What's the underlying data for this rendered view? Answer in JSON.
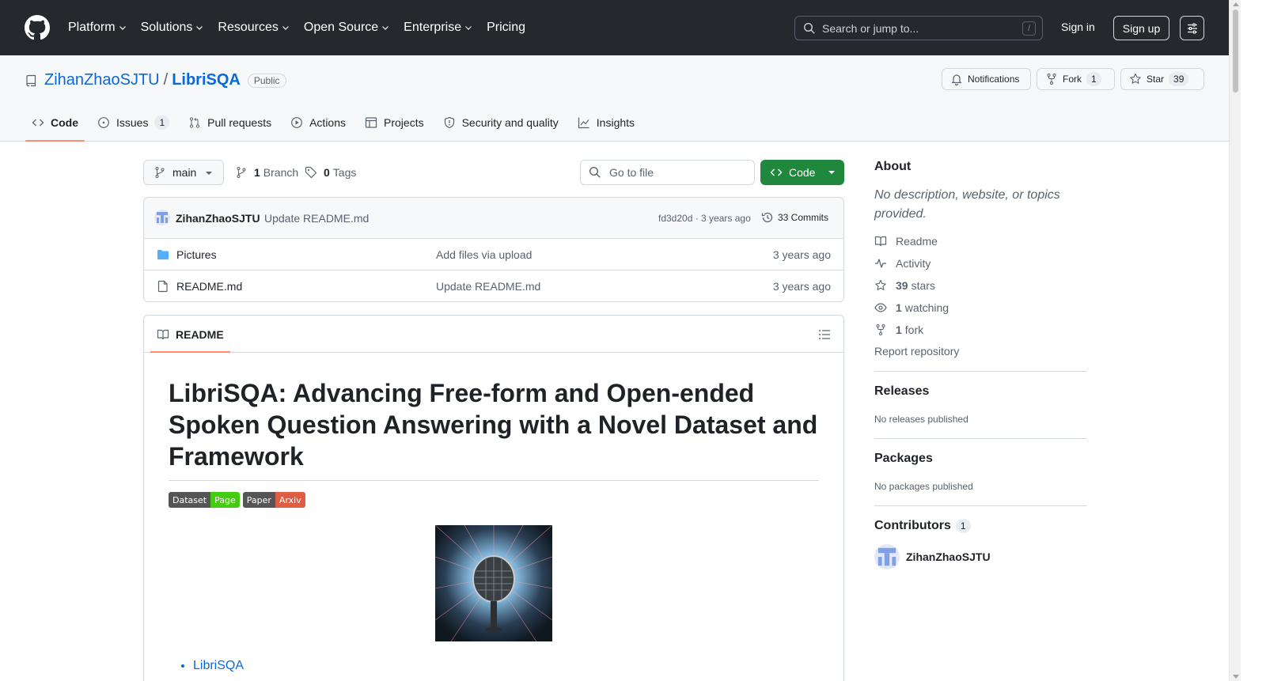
{
  "topnav": {
    "items": [
      "Platform",
      "Solutions",
      "Resources",
      "Open Source",
      "Enterprise",
      "Pricing"
    ],
    "search_placeholder": "Search or jump to...",
    "search_shortcut": "/",
    "signin": "Sign in",
    "signup": "Sign up"
  },
  "repo": {
    "owner": "ZihanZhaoSJTU",
    "separator": "/",
    "name": "LibriSQA",
    "visibility": "Public",
    "notifications_label": "Notifications",
    "fork_label": "Fork",
    "fork_count": "1",
    "star_label": "Star",
    "star_count": "39"
  },
  "tabs": [
    {
      "label": "Code",
      "icon": "code-icon"
    },
    {
      "label": "Issues",
      "icon": "issue-icon",
      "count": "1"
    },
    {
      "label": "Pull requests",
      "icon": "pull-request-icon"
    },
    {
      "label": "Actions",
      "icon": "play-icon"
    },
    {
      "label": "Projects",
      "icon": "table-icon"
    },
    {
      "label": "Security and quality",
      "icon": "shield-icon"
    },
    {
      "label": "Insights",
      "icon": "graph-icon"
    }
  ],
  "toolbar": {
    "branch": "main",
    "branch_count": "1",
    "branch_label": "Branch",
    "tag_count": "0",
    "tag_label": "Tags",
    "goto_placeholder": "Go to file",
    "code_button": "Code"
  },
  "commit": {
    "author": "ZihanZhaoSJTU",
    "message": "Update README.md",
    "sha_time": "fd3d20d · 3 years ago",
    "commits": "33 Commits"
  },
  "files": [
    {
      "name": "Pictures",
      "type": "folder",
      "message": "Add files via upload",
      "age": "3 years ago"
    },
    {
      "name": "README.md",
      "type": "file",
      "message": "Update README.md",
      "age": "3 years ago"
    }
  ],
  "readme": {
    "tab_label": "README",
    "title": "LibriSQA: Advancing Free-form and Open-ended Spoken Question Answering with a Novel Dataset and Framework",
    "badges": [
      {
        "left": "Dataset",
        "right": "Page",
        "color": "#4c1"
      },
      {
        "left": "Paper",
        "right": "Arxiv",
        "color": "#e05d44"
      }
    ],
    "toc_first": "LibriSQA"
  },
  "sidebar": {
    "about_heading": "About",
    "about_desc": "No description, website, or topics provided.",
    "readme": "Readme",
    "activity": "Activity",
    "stars_count": "39",
    "stars_label": "stars",
    "watching_count": "1",
    "watching_label": "watching",
    "forks_count": "1",
    "forks_label": "fork",
    "report": "Report repository",
    "releases_heading": "Releases",
    "releases_text": "No releases published",
    "packages_heading": "Packages",
    "packages_text": "No packages published",
    "contributors_heading": "Contributors",
    "contributors_count": "1",
    "contributor_name": "ZihanZhaoSJTU"
  },
  "colors": {
    "header_bg": "#25292e",
    "link": "#0969da",
    "primary_button": "#1f883d",
    "active_tab_underline": "#fd8c73"
  }
}
